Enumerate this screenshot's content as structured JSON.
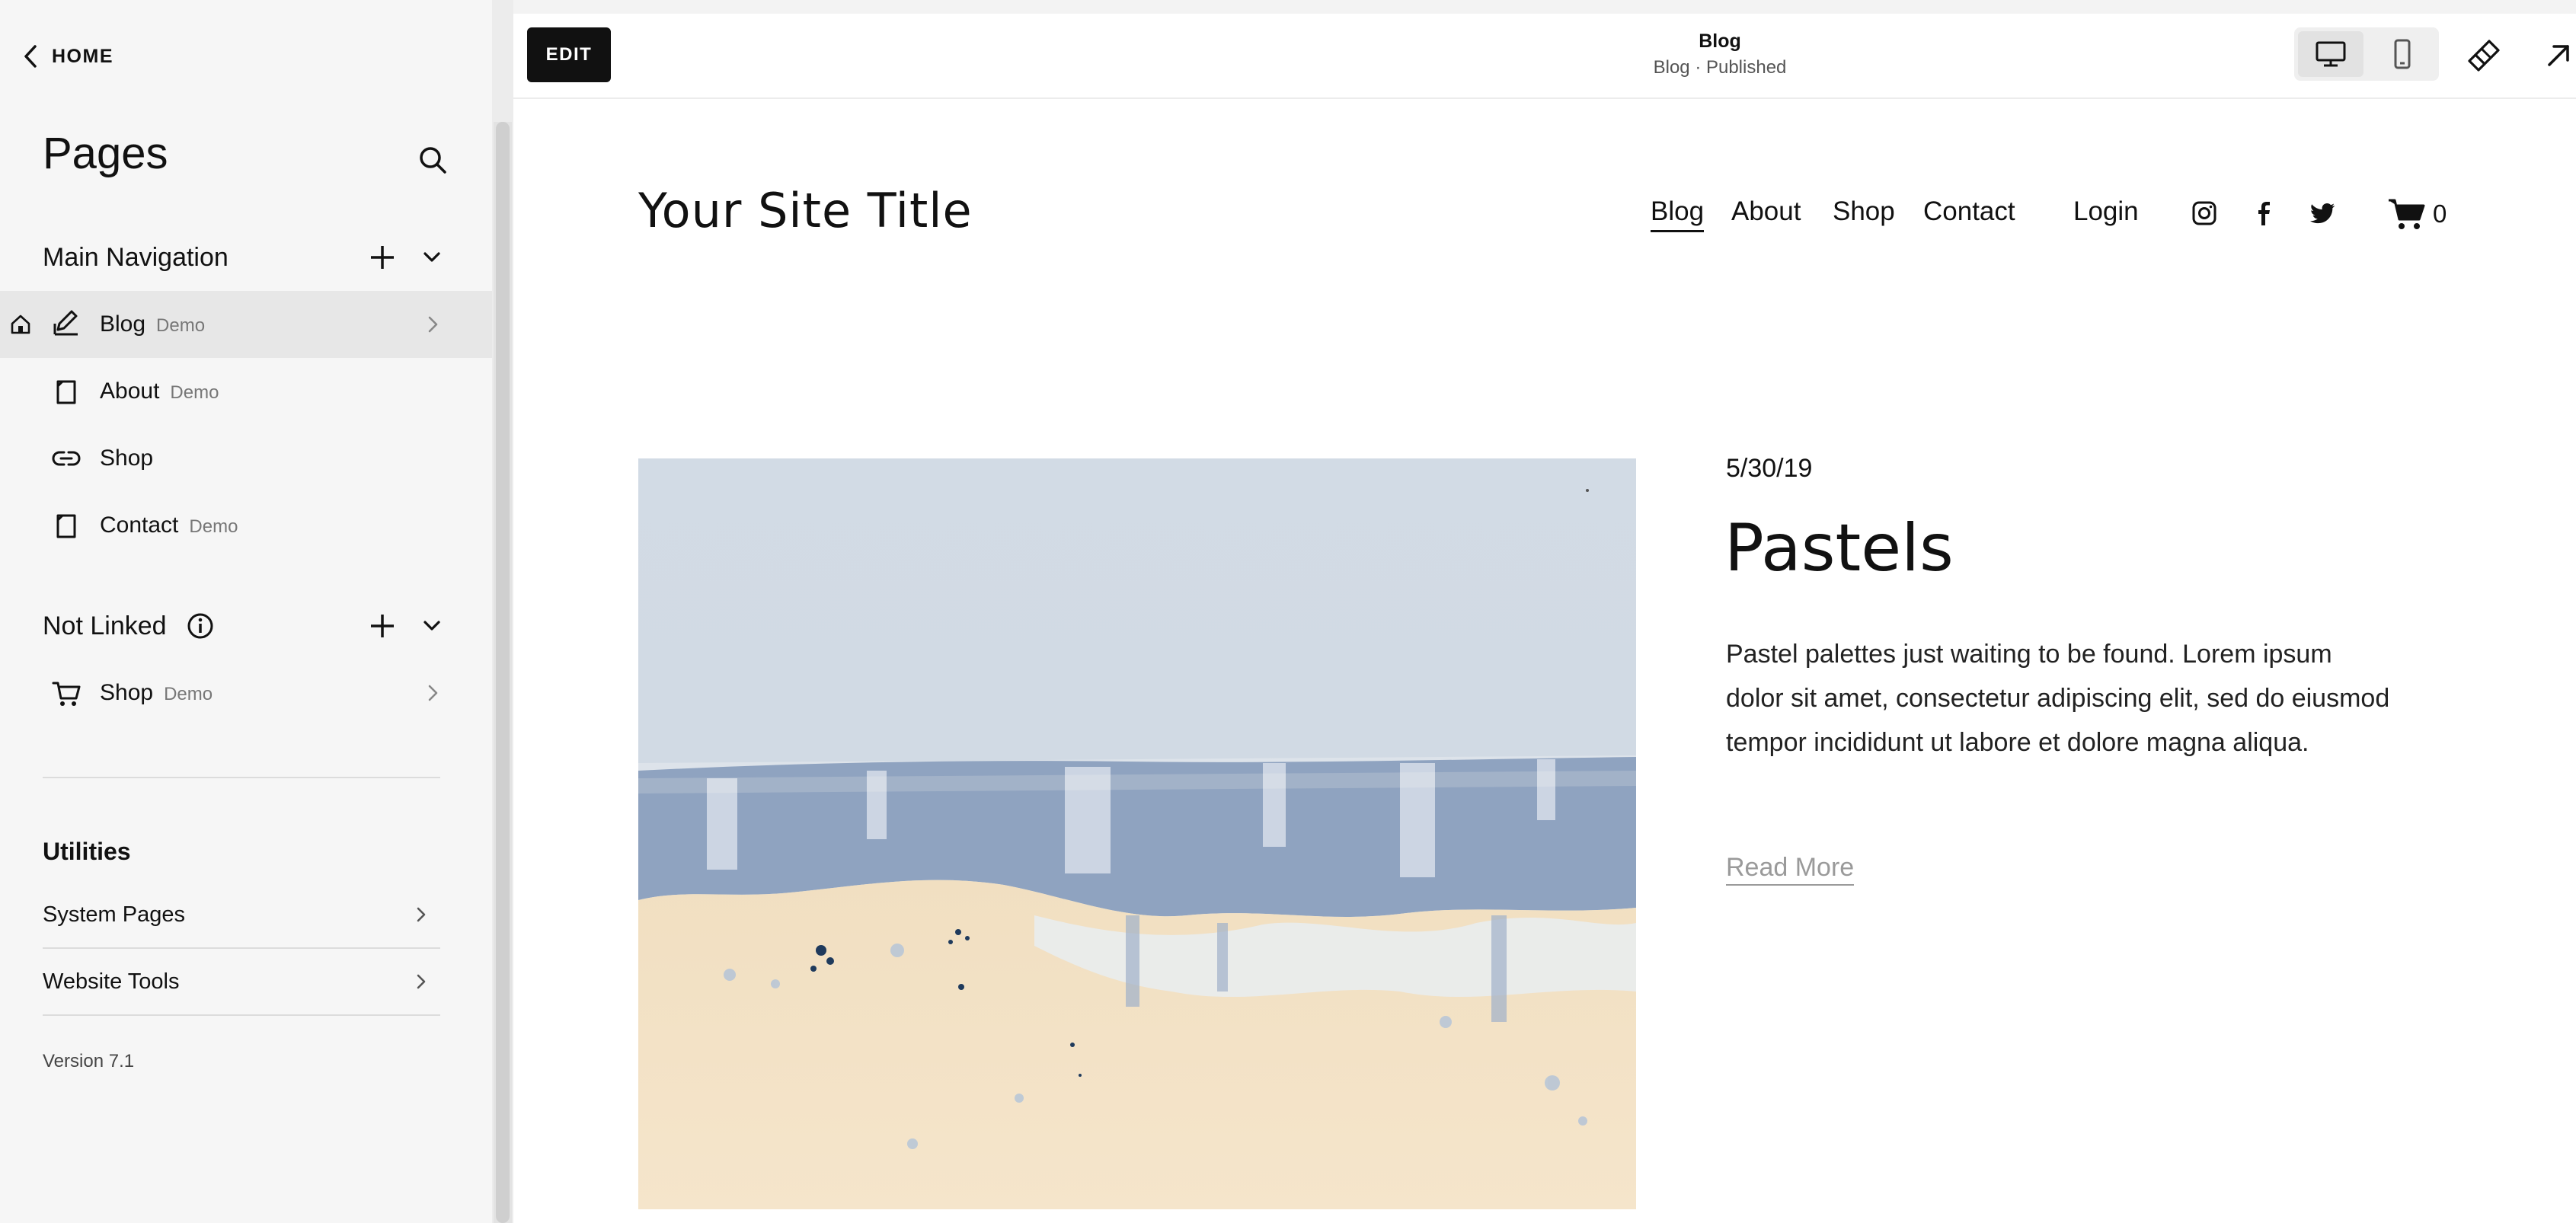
{
  "sidebar": {
    "home_label": "HOME",
    "title": "Pages",
    "main_navigation": {
      "label": "Main Navigation",
      "items": [
        {
          "title": "Blog",
          "badge": "Demo",
          "icon": "blog-icon"
        },
        {
          "title": "About",
          "badge": "Demo",
          "icon": "page-icon"
        },
        {
          "title": "Shop",
          "badge": "",
          "icon": "link-icon"
        },
        {
          "title": "Contact",
          "badge": "Demo",
          "icon": "page-icon"
        }
      ]
    },
    "not_linked": {
      "label": "Not Linked",
      "items": [
        {
          "title": "Shop",
          "badge": "Demo",
          "icon": "cart-icon"
        }
      ]
    },
    "utilities": {
      "label": "Utilities",
      "items": [
        {
          "label": "System Pages"
        },
        {
          "label": "Website Tools"
        }
      ]
    },
    "version": "Version 7.1"
  },
  "topbar": {
    "edit_label": "EDIT",
    "page_name": "Blog",
    "page_status": "Blog · Published"
  },
  "site": {
    "title": "Your Site Title",
    "nav": [
      "Blog",
      "About",
      "Shop",
      "Contact"
    ],
    "login": "Login",
    "cart_count": "0",
    "social_icons": [
      "instagram-icon",
      "facebook-icon",
      "twitter-icon"
    ]
  },
  "post": {
    "date": "5/30/19",
    "title": "Pastels",
    "excerpt": "Pastel palettes just waiting to be found. Lorem ipsum dolor sit amet, consectetur adipiscing elit, sed do eiusmod tempor incididunt ut labore et dolore magna aliqua.",
    "read_more": "Read More"
  },
  "colors": {
    "sidebar_bg": "#f6f6f6",
    "active_row": "#e7e7e7",
    "edit_button": "#111111",
    "image_sky": "#d3dce5",
    "image_blue": "#8fa3c0",
    "image_sand": "#f2e1c4"
  }
}
